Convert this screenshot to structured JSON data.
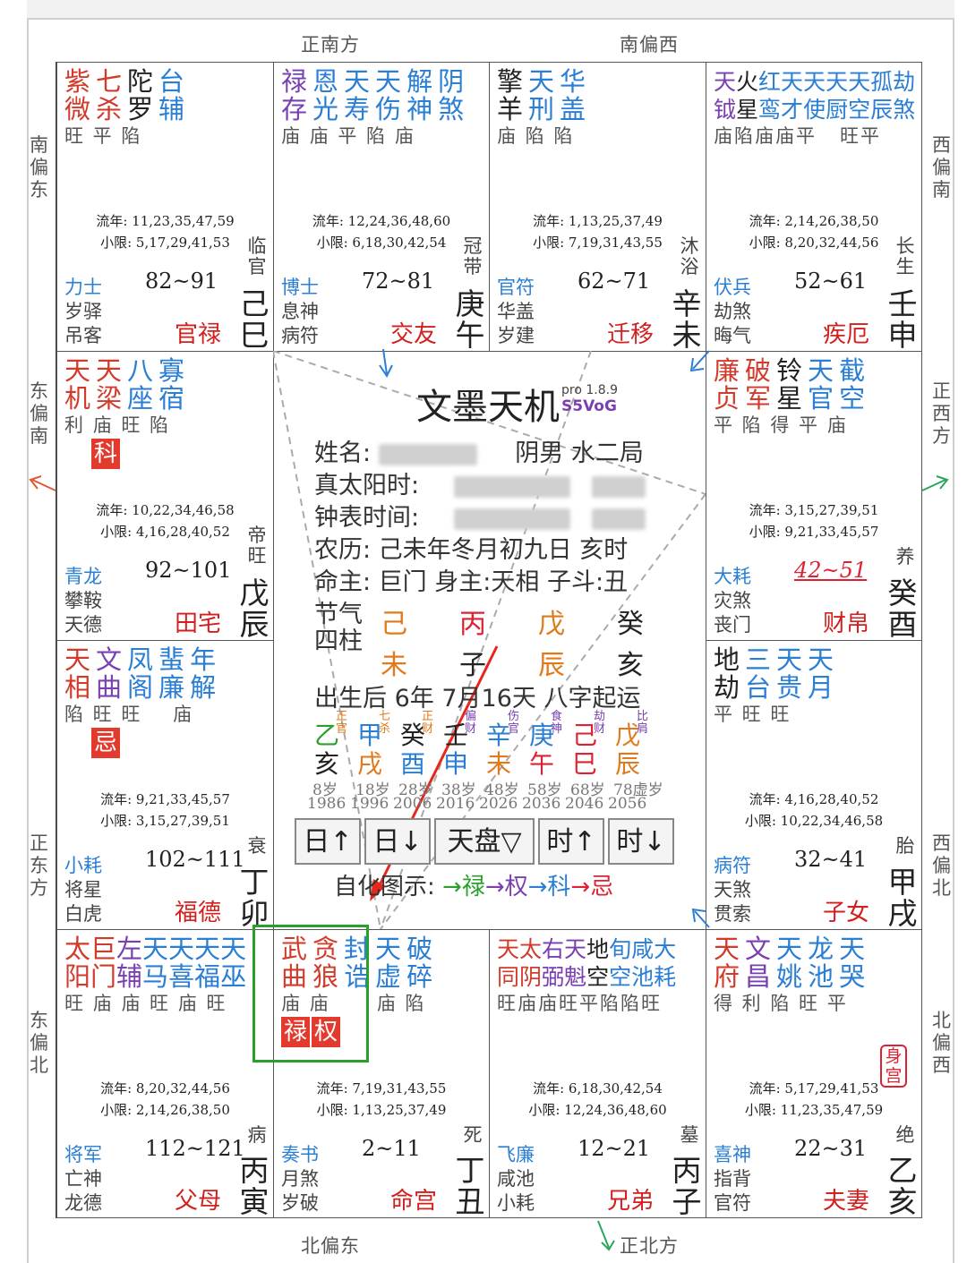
{
  "directions": {
    "top_left": "正南方",
    "top_right": "南偏西",
    "bottom_left": "北偏东",
    "bottom_right": "正北方",
    "left_1": "南偏东",
    "left_2": "东偏南",
    "left_3": "正东方",
    "left_4": "东偏北",
    "right_1": "西偏南",
    "right_2": "正西方",
    "right_3": "西偏北",
    "right_4": "北偏西"
  },
  "palaces": {
    "si": {
      "stars": [
        {
          "t": "紫\n微",
          "c": "#d23a2a"
        },
        {
          "t": "七\n杀",
          "c": "#d23a2a"
        },
        {
          "t": "陀\n罗",
          "c": "#222"
        },
        {
          "t": "台\n辅",
          "c": "#2a7fd4"
        }
      ],
      "bright": "旺 平 陷",
      "flow_year": "流年: 11,23,35,47,59",
      "small_limit": "小限: 5,17,29,41,53",
      "god1": "力士",
      "god2": "岁驿",
      "god3": "吊客",
      "age": "82~91",
      "palace": "官禄",
      "stage": "临官",
      "stem": "己巳"
    },
    "wu": {
      "stars": [
        {
          "t": "禄\n存",
          "c": "#7a3fb0"
        },
        {
          "t": "恩\n光",
          "c": "#2a7fd4"
        },
        {
          "t": "天\n寿",
          "c": "#2a7fd4"
        },
        {
          "t": "天\n伤",
          "c": "#2a7fd4"
        },
        {
          "t": "解\n神",
          "c": "#2a7fd4"
        },
        {
          "t": "阴\n煞",
          "c": "#2a7fd4"
        }
      ],
      "bright": "庙 庙 平 陷 庙",
      "flow_year": "流年: 12,24,36,48,60",
      "small_limit": "小限: 6,18,30,42,54",
      "god1": "博士",
      "god2": "息神",
      "god3": "病符",
      "age": "72~81",
      "palace": "交友",
      "stage": "冠带",
      "stem": "庚午"
    },
    "wei": {
      "stars": [
        {
          "t": "擎\n羊",
          "c": "#222"
        },
        {
          "t": "天\n刑",
          "c": "#2a7fd4"
        },
        {
          "t": "华\n盖",
          "c": "#2a7fd4"
        }
      ],
      "bright": "庙 陷 陷",
      "flow_year": "流年: 1,13,25,37,49",
      "small_limit": "小限: 7,19,31,43,55",
      "god1": "官符",
      "god2": "华盖",
      "god3": "岁建",
      "age": "62~71",
      "palace": "迁移",
      "stage": "沐浴",
      "stem": "辛未"
    },
    "shen": {
      "stars": [
        {
          "t": "天\n钺",
          "c": "#7a3fb0"
        },
        {
          "t": "火\n星",
          "c": "#222"
        },
        {
          "t": "红\n鸾",
          "c": "#2a7fd4"
        },
        {
          "t": "天\n才",
          "c": "#2a7fd4"
        },
        {
          "t": "天\n使",
          "c": "#2a7fd4"
        },
        {
          "t": "天\n厨",
          "c": "#2a7fd4"
        },
        {
          "t": "天\n空",
          "c": "#2a7fd4"
        },
        {
          "t": "孤\n辰",
          "c": "#2a7fd4"
        },
        {
          "t": "劫\n煞",
          "c": "#2a7fd4"
        }
      ],
      "bright": "庙陷庙庙平   旺平",
      "flow_year": "流年: 2,14,26,38,50",
      "small_limit": "小限: 8,20,32,44,56",
      "god1": "伏兵",
      "god2": "劫煞",
      "god3": "晦气",
      "age": "52~61",
      "palace": "疾厄",
      "stage": "长生",
      "stem": "壬申"
    },
    "chen": {
      "stars": [
        {
          "t": "天\n机",
          "c": "#d23a2a"
        },
        {
          "t": "天\n梁",
          "c": "#d23a2a"
        },
        {
          "t": "八\n座",
          "c": "#2a7fd4"
        },
        {
          "t": "寡\n宿",
          "c": "#2a7fd4"
        }
      ],
      "bright": "利 庙 旺 陷",
      "mark": "科",
      "flow_year": "流年: 10,22,34,46,58",
      "small_limit": "小限: 4,16,28,40,52",
      "god1": "青龙",
      "god2": "攀鞍",
      "god3": "天德",
      "age": "92~101",
      "palace": "田宅",
      "stage": "帝旺",
      "stem": "戊辰"
    },
    "you": {
      "stars": [
        {
          "t": "廉\n贞",
          "c": "#d23a2a"
        },
        {
          "t": "破\n军",
          "c": "#d23a2a"
        },
        {
          "t": "铃\n星",
          "c": "#222"
        },
        {
          "t": "天\n官",
          "c": "#2a7fd4"
        },
        {
          "t": "截\n空",
          "c": "#2a7fd4"
        }
      ],
      "bright": "平 陷 得 平 庙",
      "flow_year": "流年: 3,15,27,39,51",
      "small_limit": "小限: 9,21,33,45,57",
      "god1": "大耗",
      "god2": "灾煞",
      "god3": "丧门",
      "age": "42~51",
      "palace": "财帛",
      "stage": "养",
      "stem": "癸酉"
    },
    "mao": {
      "stars": [
        {
          "t": "天\n相",
          "c": "#d23a2a"
        },
        {
          "t": "文\n曲",
          "c": "#7a3fb0"
        },
        {
          "t": "凤\n阁",
          "c": "#2a7fd4"
        },
        {
          "t": "蜚\n廉",
          "c": "#2a7fd4"
        },
        {
          "t": "年\n解",
          "c": "#2a7fd4"
        }
      ],
      "bright": "陷 旺 旺    庙",
      "mark": "忌",
      "flow_year": "流年: 9,21,33,45,57",
      "small_limit": "小限: 3,15,27,39,51",
      "god1": "小耗",
      "god2": "将星",
      "god3": "白虎",
      "age": "102~111",
      "palace": "福德",
      "stage": "衰",
      "stem": "丁卯"
    },
    "xu": {
      "stars": [
        {
          "t": "地\n劫",
          "c": "#222"
        },
        {
          "t": "三\n台",
          "c": "#2a7fd4"
        },
        {
          "t": "天\n贵",
          "c": "#2a7fd4"
        },
        {
          "t": "天\n月",
          "c": "#2a7fd4"
        }
      ],
      "bright": "平 旺 旺",
      "flow_year": "流年: 4,16,28,40,52",
      "small_limit": "小限: 10,22,34,46,58",
      "god1": "病符",
      "god2": "天煞",
      "god3": "贯索",
      "age": "32~41",
      "palace": "子女",
      "stage": "胎",
      "stem": "甲戌"
    },
    "yin": {
      "stars": [
        {
          "t": "太\n阳",
          "c": "#d23a2a"
        },
        {
          "t": "巨\n门",
          "c": "#d23a2a"
        },
        {
          "t": "左\n辅",
          "c": "#7a3fb0"
        },
        {
          "t": "天\n马",
          "c": "#2a7fd4"
        },
        {
          "t": "天\n喜",
          "c": "#2a7fd4"
        },
        {
          "t": "天\n福",
          "c": "#2a7fd4"
        },
        {
          "t": "天\n巫",
          "c": "#2a7fd4"
        }
      ],
      "bright": "旺 庙 庙 旺 庙 旺",
      "flow_year": "流年: 8,20,32,44,56",
      "small_limit": "小限: 2,14,26,38,50",
      "god1": "将军",
      "god2": "亡神",
      "god3": "龙德",
      "age": "112~121",
      "palace": "父母",
      "stage": "病",
      "stem": "丙寅"
    },
    "chou": {
      "stars": [
        {
          "t": "武\n曲",
          "c": "#d23a2a"
        },
        {
          "t": "贪\n狼",
          "c": "#d23a2a"
        },
        {
          "t": "封\n诰",
          "c": "#2a7fd4"
        },
        {
          "t": "天\n虚",
          "c": "#2a7fd4"
        },
        {
          "t": "破\n碎",
          "c": "#2a7fd4"
        }
      ],
      "bright": "庙 庙      庙 陷",
      "mark": "禄",
      "mark2": "权",
      "flow_year": "流年: 7,19,31,43,55",
      "small_limit": "小限: 1,13,25,37,49",
      "god1": "奏书",
      "god2": "月煞",
      "god3": "岁破",
      "age": "2~11",
      "palace": "命宫",
      "stage": "死",
      "stem": "丁丑"
    },
    "zi": {
      "stars": [
        {
          "t": "天\n同",
          "c": "#d23a2a"
        },
        {
          "t": "太\n阴",
          "c": "#d23a2a"
        },
        {
          "t": "右\n弼",
          "c": "#7a3fb0"
        },
        {
          "t": "天\n魁",
          "c": "#7a3fb0"
        },
        {
          "t": "地\n空",
          "c": "#222"
        },
        {
          "t": "旬\n空",
          "c": "#2a7fd4"
        },
        {
          "t": "咸\n池",
          "c": "#2a7fd4"
        },
        {
          "t": "大\n耗",
          "c": "#2a7fd4"
        }
      ],
      "bright": "旺庙庙旺平陷陷旺",
      "flow_year": "流年: 6,18,30,42,54",
      "small_limit": "小限: 12,24,36,48,60",
      "god1": "飞廉",
      "god2": "咸池",
      "god3": "小耗",
      "age": "12~21",
      "palace": "兄弟",
      "stage": "墓",
      "stem": "丙子"
    },
    "hai": {
      "stars": [
        {
          "t": "天\n府",
          "c": "#d23a2a"
        },
        {
          "t": "文\n昌",
          "c": "#7a3fb0"
        },
        {
          "t": "天\n姚",
          "c": "#2a7fd4"
        },
        {
          "t": "龙\n池",
          "c": "#2a7fd4"
        },
        {
          "t": "天\n哭",
          "c": "#2a7fd4"
        }
      ],
      "bright": "得 利 陷 旺 平",
      "seal": "身\n宫",
      "flow_year": "流年: 5,17,29,41,53",
      "small_limit": "小限: 11,23,35,47,59",
      "god1": "喜神",
      "god2": "指背",
      "god3": "官符",
      "age": "22~31",
      "palace": "夫妻",
      "stage": "绝",
      "stem": "乙亥"
    }
  },
  "center": {
    "title": "文墨天机",
    "pro": "pro 1.8.9",
    "version": "S5VoG",
    "name_label": "姓名:",
    "gender_bureau": "阴男 水二局",
    "solar_label": "真太阳时:",
    "clock_label": "钟表时间:",
    "lunar": "农历: 己未年冬月初九日 亥时",
    "master": "命主: 巨门 身主:天相 子斗:丑",
    "jieqi": "节气",
    "sizhu": "四柱",
    "pillars_top": [
      "己",
      "丙",
      "戊",
      "癸"
    ],
    "pillars_bottom": [
      "未",
      "子",
      "辰",
      "亥"
    ],
    "start_luck": "出生后 6年 7月16天 八字起运",
    "luck_stems": [
      "乙",
      "甲",
      "癸",
      "壬",
      "辛",
      "庚",
      "己",
      "戊"
    ],
    "luck_tags": [
      "正官",
      "七杀",
      "正财",
      "偏财",
      "伤官",
      "食神",
      "劫财",
      "比肩"
    ],
    "luck_branches": [
      "亥",
      "戌",
      "酉",
      "申",
      "未",
      "午",
      "巳",
      "辰"
    ],
    "luck_ages": [
      "8岁",
      "18岁",
      "28岁",
      "38岁",
      "48岁",
      "58岁",
      "68岁",
      "78虚岁"
    ],
    "luck_years": [
      "1986",
      "1996",
      "2006",
      "2016",
      "2026",
      "2036",
      "2046",
      "2056"
    ],
    "buttons": [
      "日↑",
      "日↓",
      "天盘▽",
      "时↑",
      "时↓"
    ],
    "legend_label": "自化图示:",
    "legend_items": [
      "→禄",
      "→权",
      "→科",
      "→忌"
    ]
  }
}
